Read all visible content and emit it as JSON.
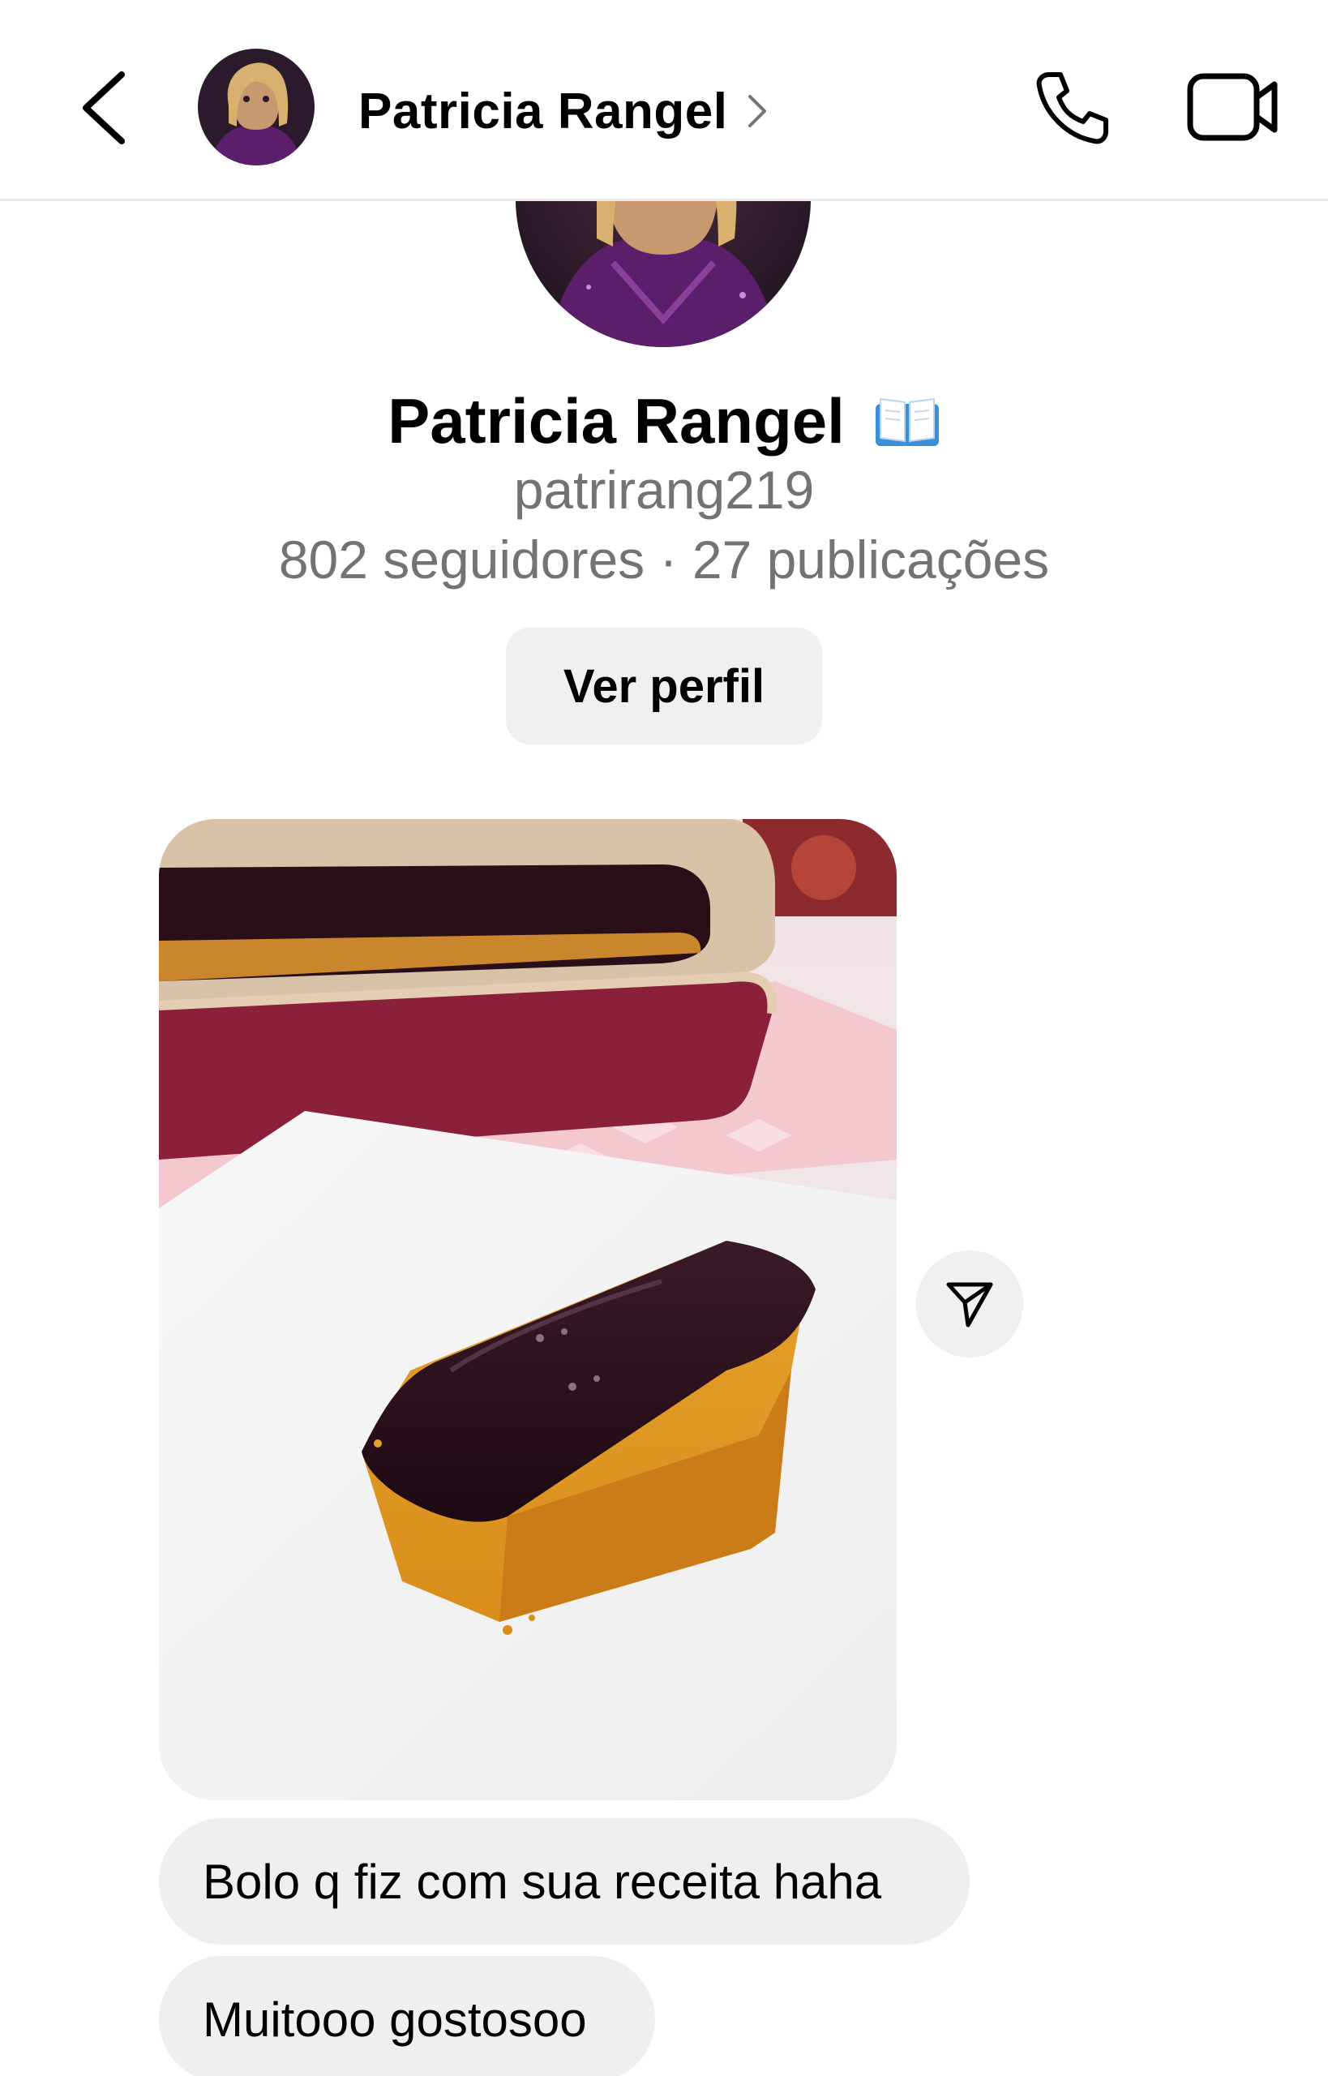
{
  "header": {
    "contact_name": "Patricia Rangel",
    "icons": [
      "chevron-left-icon",
      "avatar",
      "chevron-right-icon",
      "phone-icon",
      "video-camera-icon"
    ]
  },
  "profile": {
    "name": "Patricia Rangel",
    "name_emoji": "open-book-icon",
    "username": "patrirang219",
    "stats": "802 seguidores · 27 publicações",
    "view_profile_label": "Ver perfil"
  },
  "messages": [
    {
      "type": "photo",
      "description_icon": "carrot-cake-photo"
    },
    {
      "type": "text",
      "text": "Bolo q fiz com sua receita haha"
    },
    {
      "type": "text",
      "text": "Muitooo gostosoo"
    }
  ],
  "colors": {
    "bubble_background": "#efefef",
    "button_background": "#eef0f2",
    "secondary_text": "#737373",
    "header_divider": "#ececec"
  }
}
